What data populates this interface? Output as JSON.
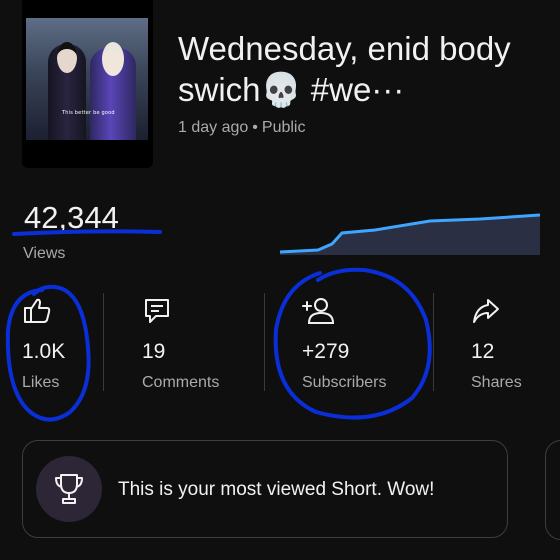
{
  "video": {
    "title": "Wednesday, enid body swich💀 #we···",
    "age": "1 day ago",
    "separator": "•",
    "visibility": "Public",
    "thumbnail_caption": "This better be good"
  },
  "views": {
    "value": "42,344",
    "label": "Views"
  },
  "stats": [
    {
      "icon": "thumbs-up-icon",
      "value": "1.0K",
      "label": "Likes"
    },
    {
      "icon": "comment-icon",
      "value": "19",
      "label": "Comments"
    },
    {
      "icon": "person-add-icon",
      "value": "+279",
      "label": "Subscribers"
    },
    {
      "icon": "share-icon",
      "value": "12",
      "label": "Shares"
    }
  ],
  "banner": {
    "icon": "trophy-icon",
    "text": "This is your most viewed Short. Wow!"
  },
  "colors": {
    "background": "#0f0f0f",
    "chart_line": "#3ea6ff",
    "annotation": "#0a2fd9",
    "secondary_text": "#aaaaaa"
  }
}
